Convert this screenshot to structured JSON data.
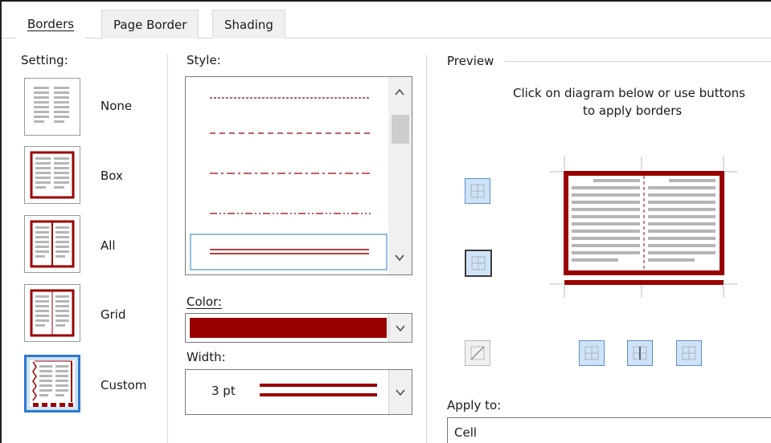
{
  "tabs": [
    {
      "label": "Borders"
    },
    {
      "label": "Page Border"
    },
    {
      "label": "Shading"
    }
  ],
  "setting": {
    "title": "Setting:",
    "items": [
      {
        "label": "None"
      },
      {
        "label": "Box"
      },
      {
        "label": "All"
      },
      {
        "label": "Grid"
      },
      {
        "label": "Custom"
      }
    ],
    "selected": "Custom"
  },
  "style": {
    "title": "Style:",
    "selected_style": "double line"
  },
  "color": {
    "title": "Color:",
    "value": "#990000"
  },
  "width": {
    "title": "Width:",
    "value": "3 pt"
  },
  "preview": {
    "title": "Preview",
    "instructions_line1": "Click on diagram below or use buttons",
    "instructions_line2": "to apply borders"
  },
  "apply_to": {
    "title": "Apply to:",
    "value": "Cell"
  },
  "colors": {
    "border_red": "#990000",
    "accent_blue": "#2b79d0"
  }
}
